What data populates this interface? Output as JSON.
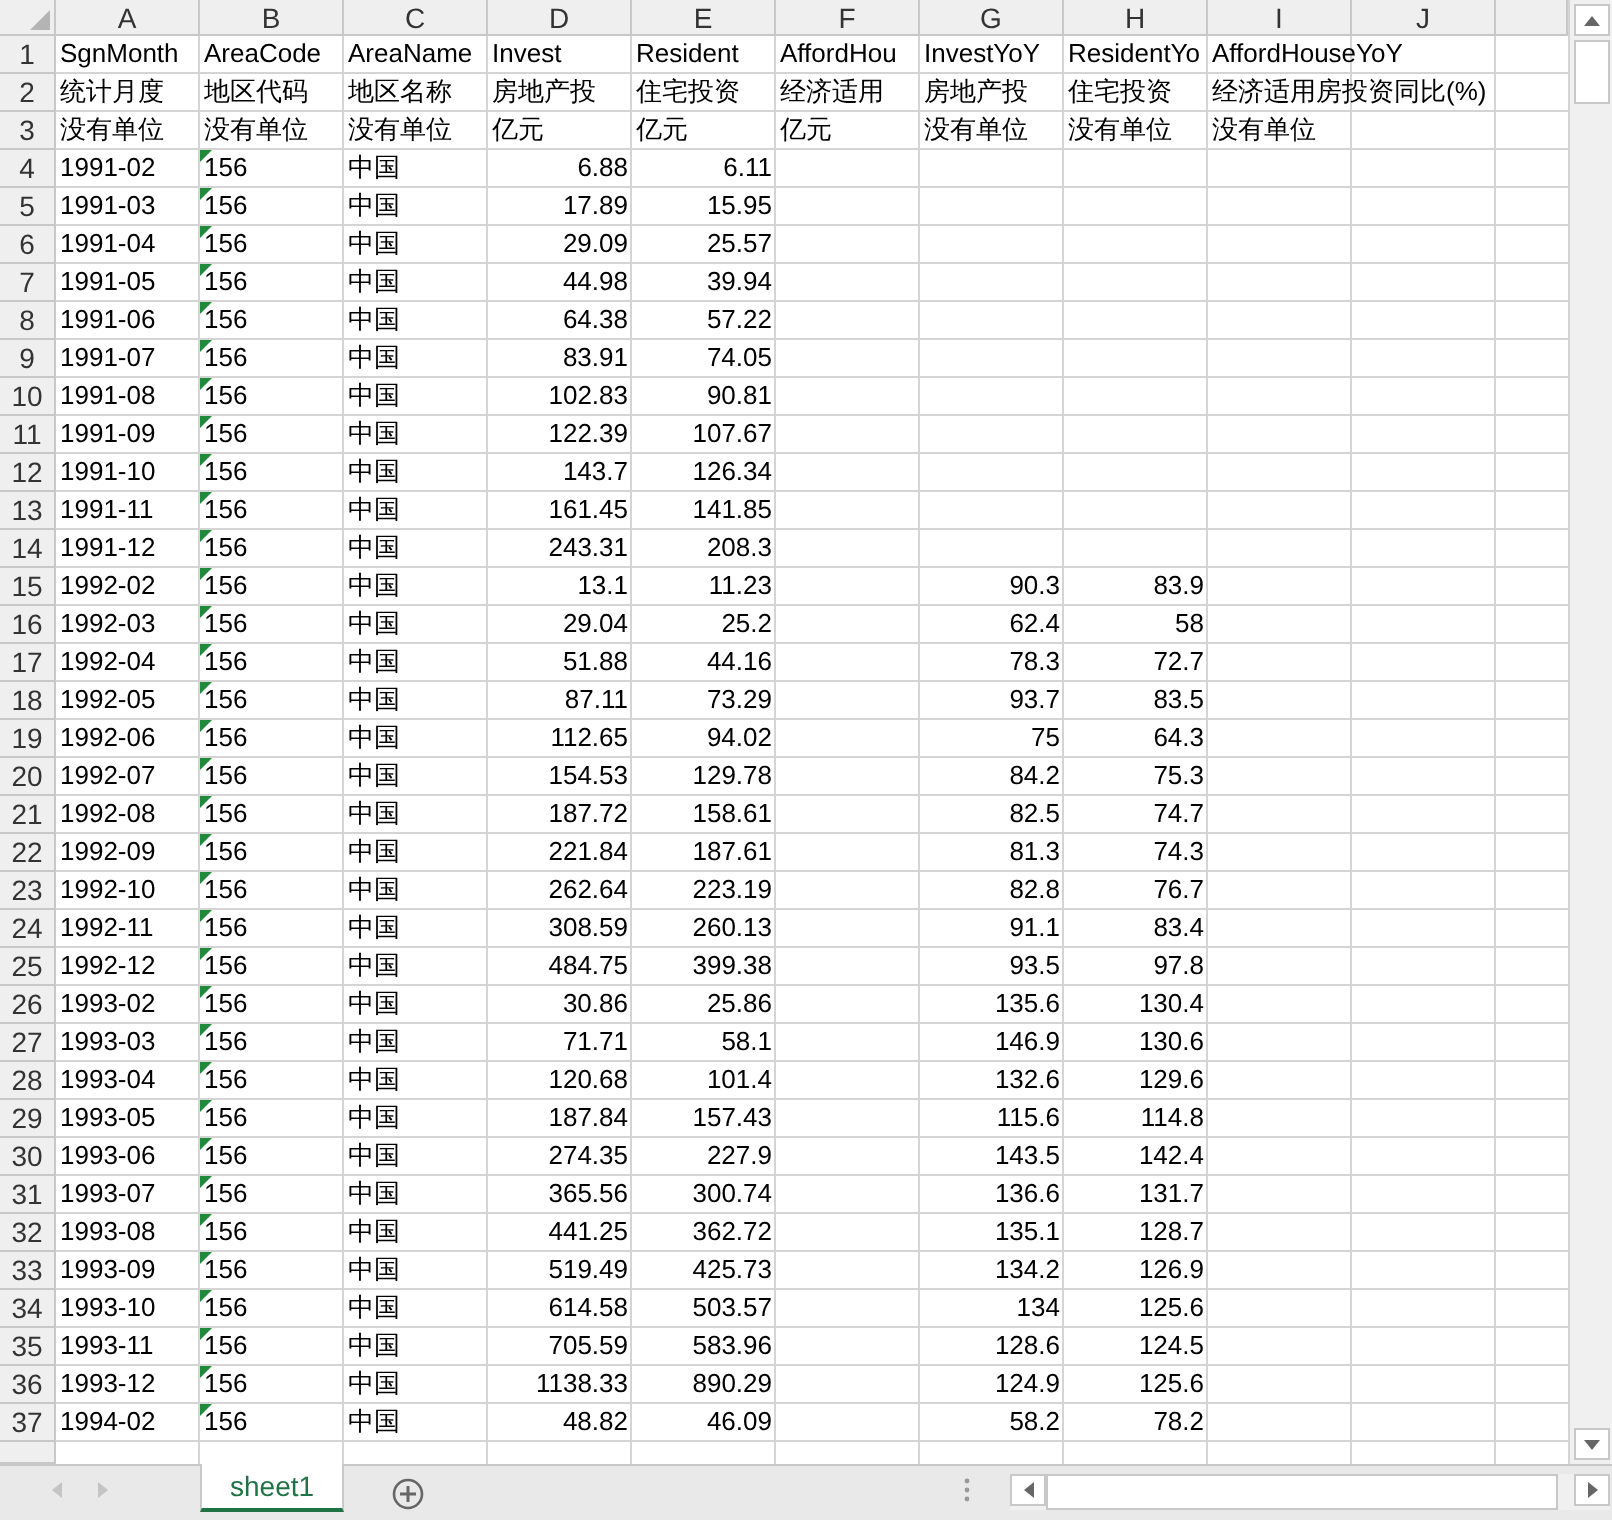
{
  "columns": [
    {
      "letter": "A",
      "kind": "text"
    },
    {
      "letter": "B",
      "kind": "text"
    },
    {
      "letter": "C",
      "kind": "text"
    },
    {
      "letter": "D",
      "kind": "number"
    },
    {
      "letter": "E",
      "kind": "number"
    },
    {
      "letter": "F",
      "kind": "number"
    },
    {
      "letter": "G",
      "kind": "number"
    },
    {
      "letter": "H",
      "kind": "number"
    },
    {
      "letter": "I",
      "kind": "number"
    },
    {
      "letter": "J",
      "kind": "text"
    }
  ],
  "rows": [
    {
      "row": "1",
      "kind": "header",
      "cells": {
        "A": "SgnMonth",
        "B": "AreaCode",
        "C": "AreaName",
        "D": "Invest",
        "E": "Resident",
        "F": "AffordHou",
        "G": "InvestYoY",
        "H": "ResidentYo",
        "I": "AffordHouseYoY"
      }
    },
    {
      "row": "2",
      "kind": "header",
      "cells": {
        "A": "统计月度",
        "B": "地区代码",
        "C": "地区名称",
        "D": "房地产投",
        "E": "住宅投资",
        "F": "经济适用",
        "G": "房地产投",
        "H": "住宅投资",
        "I": "经济适用房投资同比(%)"
      }
    },
    {
      "row": "3",
      "kind": "header",
      "cells": {
        "A": "没有单位",
        "B": "没有单位",
        "C": "没有单位",
        "D": "亿元",
        "E": "亿元",
        "F": "亿元",
        "G": "没有单位",
        "H": "没有单位",
        "I": "没有单位"
      }
    },
    {
      "row": "4",
      "kind": "data",
      "flagged": true,
      "cells": {
        "A": "1991-02",
        "B": "156",
        "C": "中国",
        "D": "6.88",
        "E": "6.11"
      }
    },
    {
      "row": "5",
      "kind": "data",
      "flagged": true,
      "cells": {
        "A": "1991-03",
        "B": "156",
        "C": "中国",
        "D": "17.89",
        "E": "15.95"
      }
    },
    {
      "row": "6",
      "kind": "data",
      "flagged": true,
      "cells": {
        "A": "1991-04",
        "B": "156",
        "C": "中国",
        "D": "29.09",
        "E": "25.57"
      }
    },
    {
      "row": "7",
      "kind": "data",
      "flagged": true,
      "cells": {
        "A": "1991-05",
        "B": "156",
        "C": "中国",
        "D": "44.98",
        "E": "39.94"
      }
    },
    {
      "row": "8",
      "kind": "data",
      "flagged": true,
      "cells": {
        "A": "1991-06",
        "B": "156",
        "C": "中国",
        "D": "64.38",
        "E": "57.22"
      }
    },
    {
      "row": "9",
      "kind": "data",
      "flagged": true,
      "cells": {
        "A": "1991-07",
        "B": "156",
        "C": "中国",
        "D": "83.91",
        "E": "74.05"
      }
    },
    {
      "row": "10",
      "kind": "data",
      "flagged": true,
      "cells": {
        "A": "1991-08",
        "B": "156",
        "C": "中国",
        "D": "102.83",
        "E": "90.81"
      }
    },
    {
      "row": "11",
      "kind": "data",
      "flagged": true,
      "cells": {
        "A": "1991-09",
        "B": "156",
        "C": "中国",
        "D": "122.39",
        "E": "107.67"
      }
    },
    {
      "row": "12",
      "kind": "data",
      "flagged": true,
      "cells": {
        "A": "1991-10",
        "B": "156",
        "C": "中国",
        "D": "143.7",
        "E": "126.34"
      }
    },
    {
      "row": "13",
      "kind": "data",
      "flagged": true,
      "cells": {
        "A": "1991-11",
        "B": "156",
        "C": "中国",
        "D": "161.45",
        "E": "141.85"
      }
    },
    {
      "row": "14",
      "kind": "data",
      "flagged": true,
      "cells": {
        "A": "1991-12",
        "B": "156",
        "C": "中国",
        "D": "243.31",
        "E": "208.3"
      }
    },
    {
      "row": "15",
      "kind": "data",
      "flagged": true,
      "cells": {
        "A": "1992-02",
        "B": "156",
        "C": "中国",
        "D": "13.1",
        "E": "11.23",
        "G": "90.3",
        "H": "83.9"
      }
    },
    {
      "row": "16",
      "kind": "data",
      "flagged": true,
      "cells": {
        "A": "1992-03",
        "B": "156",
        "C": "中国",
        "D": "29.04",
        "E": "25.2",
        "G": "62.4",
        "H": "58"
      }
    },
    {
      "row": "17",
      "kind": "data",
      "flagged": true,
      "cells": {
        "A": "1992-04",
        "B": "156",
        "C": "中国",
        "D": "51.88",
        "E": "44.16",
        "G": "78.3",
        "H": "72.7"
      }
    },
    {
      "row": "18",
      "kind": "data",
      "flagged": true,
      "cells": {
        "A": "1992-05",
        "B": "156",
        "C": "中国",
        "D": "87.11",
        "E": "73.29",
        "G": "93.7",
        "H": "83.5"
      }
    },
    {
      "row": "19",
      "kind": "data",
      "flagged": true,
      "cells": {
        "A": "1992-06",
        "B": "156",
        "C": "中国",
        "D": "112.65",
        "E": "94.02",
        "G": "75",
        "H": "64.3"
      }
    },
    {
      "row": "20",
      "kind": "data",
      "flagged": true,
      "cells": {
        "A": "1992-07",
        "B": "156",
        "C": "中国",
        "D": "154.53",
        "E": "129.78",
        "G": "84.2",
        "H": "75.3"
      }
    },
    {
      "row": "21",
      "kind": "data",
      "flagged": true,
      "cells": {
        "A": "1992-08",
        "B": "156",
        "C": "中国",
        "D": "187.72",
        "E": "158.61",
        "G": "82.5",
        "H": "74.7"
      }
    },
    {
      "row": "22",
      "kind": "data",
      "flagged": true,
      "cells": {
        "A": "1992-09",
        "B": "156",
        "C": "中国",
        "D": "221.84",
        "E": "187.61",
        "G": "81.3",
        "H": "74.3"
      }
    },
    {
      "row": "23",
      "kind": "data",
      "flagged": true,
      "cells": {
        "A": "1992-10",
        "B": "156",
        "C": "中国",
        "D": "262.64",
        "E": "223.19",
        "G": "82.8",
        "H": "76.7"
      }
    },
    {
      "row": "24",
      "kind": "data",
      "flagged": true,
      "cells": {
        "A": "1992-11",
        "B": "156",
        "C": "中国",
        "D": "308.59",
        "E": "260.13",
        "G": "91.1",
        "H": "83.4"
      }
    },
    {
      "row": "25",
      "kind": "data",
      "flagged": true,
      "cells": {
        "A": "1992-12",
        "B": "156",
        "C": "中国",
        "D": "484.75",
        "E": "399.38",
        "G": "93.5",
        "H": "97.8"
      }
    },
    {
      "row": "26",
      "kind": "data",
      "flagged": true,
      "cells": {
        "A": "1993-02",
        "B": "156",
        "C": "中国",
        "D": "30.86",
        "E": "25.86",
        "G": "135.6",
        "H": "130.4"
      }
    },
    {
      "row": "27",
      "kind": "data",
      "flagged": true,
      "cells": {
        "A": "1993-03",
        "B": "156",
        "C": "中国",
        "D": "71.71",
        "E": "58.1",
        "G": "146.9",
        "H": "130.6"
      }
    },
    {
      "row": "28",
      "kind": "data",
      "flagged": true,
      "cells": {
        "A": "1993-04",
        "B": "156",
        "C": "中国",
        "D": "120.68",
        "E": "101.4",
        "G": "132.6",
        "H": "129.6"
      }
    },
    {
      "row": "29",
      "kind": "data",
      "flagged": true,
      "cells": {
        "A": "1993-05",
        "B": "156",
        "C": "中国",
        "D": "187.84",
        "E": "157.43",
        "G": "115.6",
        "H": "114.8"
      }
    },
    {
      "row": "30",
      "kind": "data",
      "flagged": true,
      "cells": {
        "A": "1993-06",
        "B": "156",
        "C": "中国",
        "D": "274.35",
        "E": "227.9",
        "G": "143.5",
        "H": "142.4"
      }
    },
    {
      "row": "31",
      "kind": "data",
      "flagged": true,
      "cells": {
        "A": "1993-07",
        "B": "156",
        "C": "中国",
        "D": "365.56",
        "E": "300.74",
        "G": "136.6",
        "H": "131.7"
      }
    },
    {
      "row": "32",
      "kind": "data",
      "flagged": true,
      "cells": {
        "A": "1993-08",
        "B": "156",
        "C": "中国",
        "D": "441.25",
        "E": "362.72",
        "G": "135.1",
        "H": "128.7"
      }
    },
    {
      "row": "33",
      "kind": "data",
      "flagged": true,
      "cells": {
        "A": "1993-09",
        "B": "156",
        "C": "中国",
        "D": "519.49",
        "E": "425.73",
        "G": "134.2",
        "H": "126.9"
      }
    },
    {
      "row": "34",
      "kind": "data",
      "flagged": true,
      "cells": {
        "A": "1993-10",
        "B": "156",
        "C": "中国",
        "D": "614.58",
        "E": "503.57",
        "G": "134",
        "H": "125.6"
      }
    },
    {
      "row": "35",
      "kind": "data",
      "flagged": true,
      "cells": {
        "A": "1993-11",
        "B": "156",
        "C": "中国",
        "D": "705.59",
        "E": "583.96",
        "G": "128.6",
        "H": "124.5"
      }
    },
    {
      "row": "36",
      "kind": "data",
      "flagged": true,
      "cells": {
        "A": "1993-12",
        "B": "156",
        "C": "中国",
        "D": "1138.33",
        "E": "890.29",
        "G": "124.9",
        "H": "125.6"
      }
    },
    {
      "row": "37",
      "kind": "data",
      "flagged": true,
      "cells": {
        "A": "1994-02",
        "B": "156",
        "C": "中国",
        "D": "48.82",
        "E": "46.09",
        "G": "58.2",
        "H": "78.2"
      }
    }
  ],
  "tabs": [
    {
      "label": "sheet1",
      "selected": true
    }
  ]
}
